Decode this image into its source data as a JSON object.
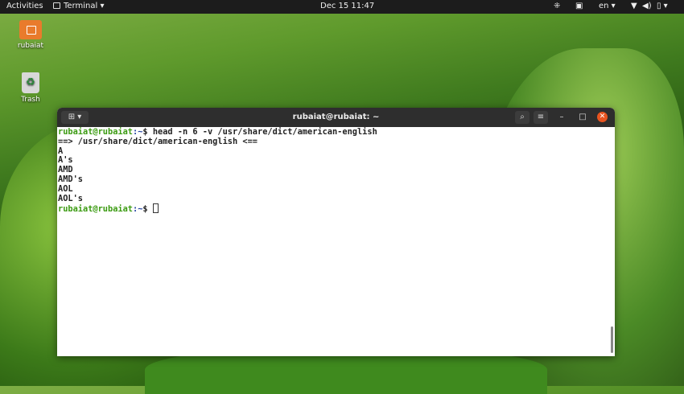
{
  "topbar": {
    "activities": "Activities",
    "app_menu": "Terminal",
    "clock": "Dec 15  11:47",
    "language": "en"
  },
  "desktop": {
    "icons": [
      {
        "label": "rubaiat",
        "icon": "home-folder-icon"
      },
      {
        "label": "Trash",
        "icon": "trash-icon"
      }
    ]
  },
  "terminal": {
    "title": "rubaiat@rubaiat: ~",
    "prompt_user": "rubaiat@rubaiat",
    "prompt_path": ":~",
    "prompt_symbol": "$ ",
    "command": "head -n 6 -v /usr/share/dict/american-english",
    "output": [
      "==> /usr/share/dict/american-english <==",
      "A",
      "A's",
      "AMD",
      "AMD's",
      "AOL",
      "AOL's"
    ]
  }
}
